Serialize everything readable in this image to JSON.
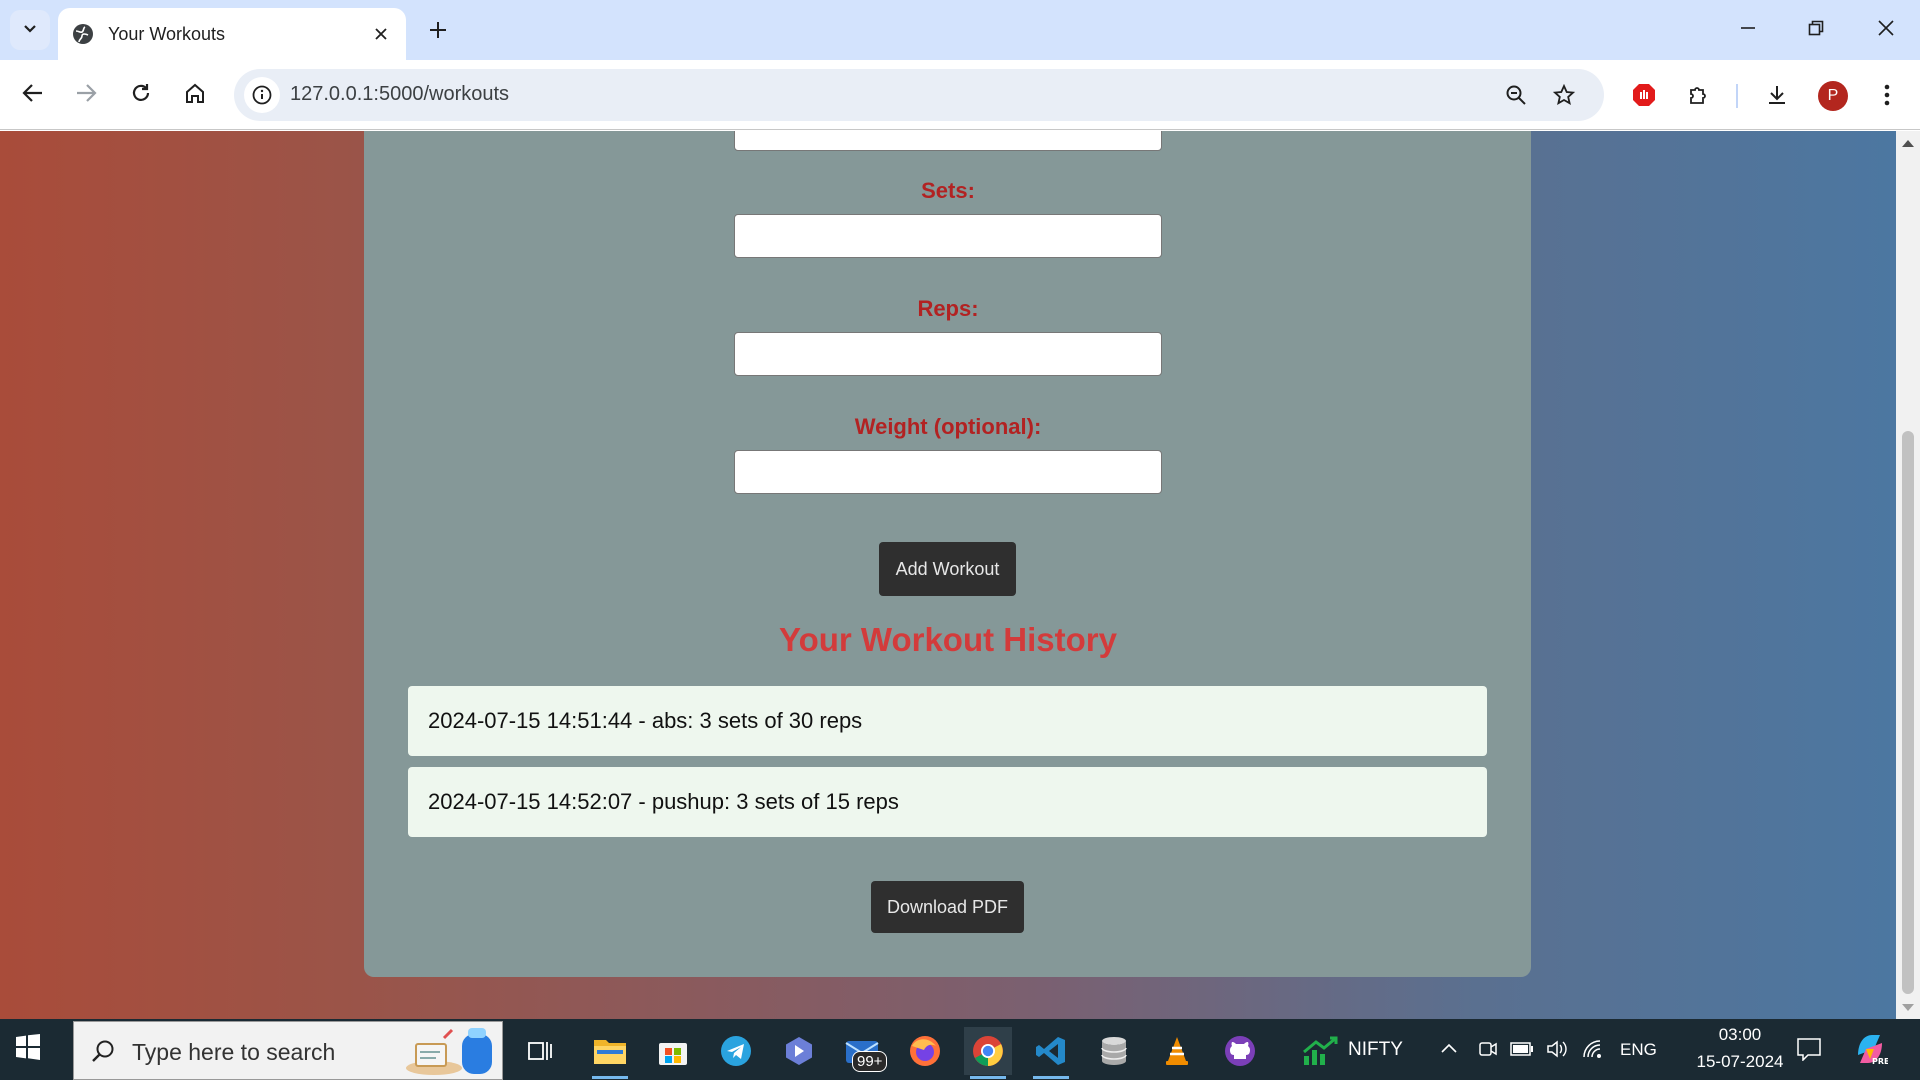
{
  "browser": {
    "tab_title": "Your Workouts",
    "url": "127.0.0.1:5000/workouts",
    "avatar_letter": "P"
  },
  "form": {
    "sets_label": "Sets:",
    "reps_label": "Reps:",
    "weight_label": "Weight (optional):",
    "sets_value": "",
    "reps_value": "",
    "weight_value": "",
    "submit_label": "Add Workout"
  },
  "history": {
    "title": "Your Workout History",
    "items": [
      "2024-07-15 14:51:44 - abs: 3 sets of 30 reps",
      "2024-07-15 14:52:07 - pushup: 3 sets of 15 reps"
    ],
    "download_label": "Download PDF"
  },
  "taskbar": {
    "search_placeholder": "Type here to search",
    "mail_badge": "99+",
    "nifty_label": "NIFTY",
    "language": "ENG",
    "time": "03:00",
    "date": "15-07-2024"
  },
  "colors": {
    "label": "#b22222",
    "history_title": "#d33b3b",
    "card": "#859898",
    "button": "#2f2f2f"
  }
}
